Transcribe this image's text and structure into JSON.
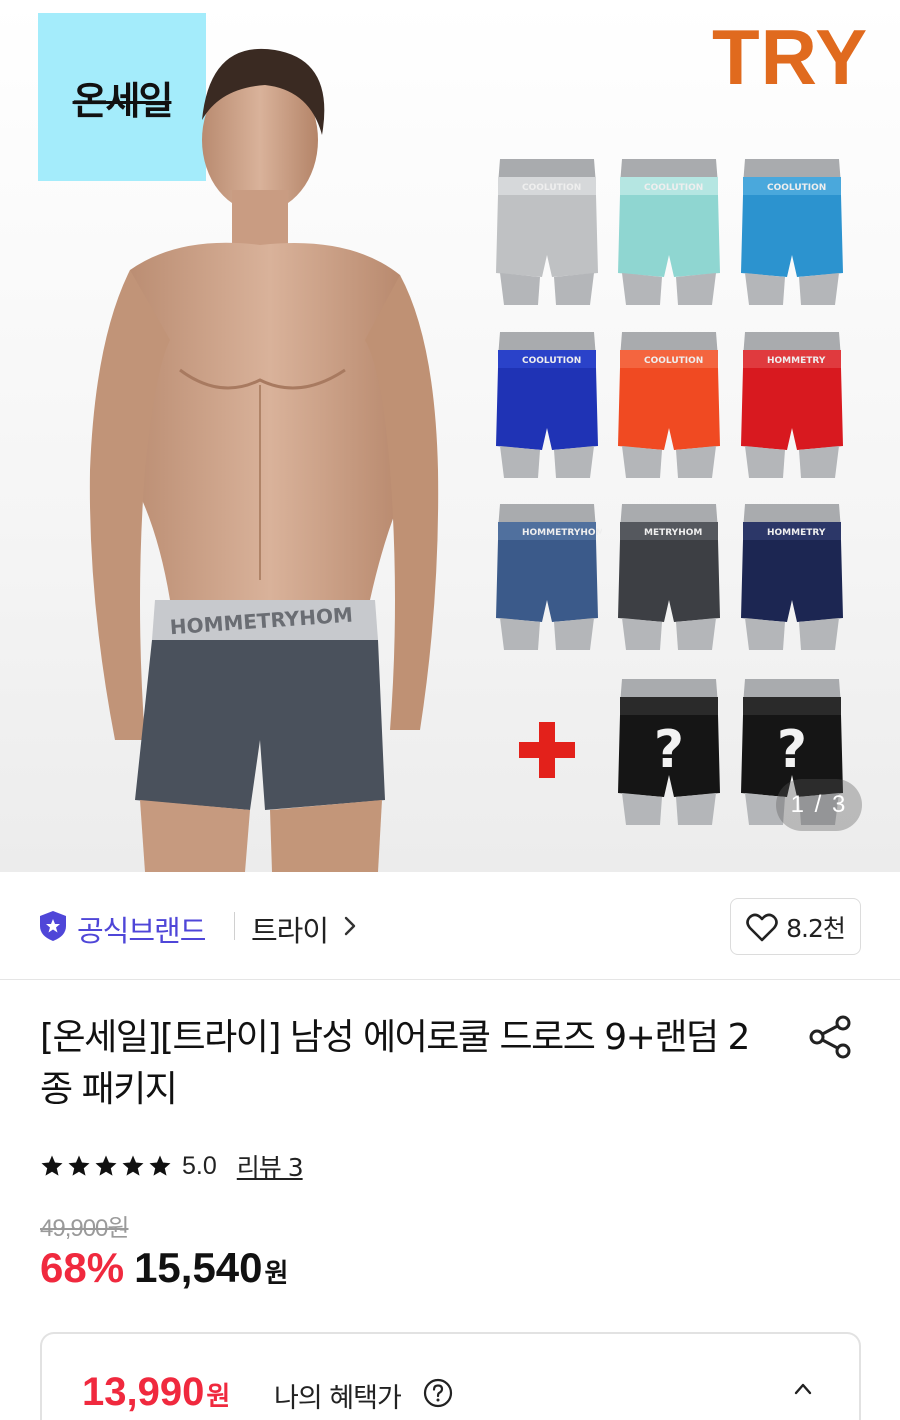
{
  "hero": {
    "badge_text": "온세일",
    "brand_logo": "TRY",
    "counter": "1 / 3",
    "underwear_colors": [
      {
        "color": "#bfc1c3",
        "band": "#d6d8da",
        "band_text": "COOLUTION"
      },
      {
        "color": "#8fd6d1",
        "band": "#b5e6e2",
        "band_text": "COOLUTION"
      },
      {
        "color": "#2c93cf",
        "band": "#4aa8dc",
        "band_text": "COOLUTION"
      },
      {
        "color": "#1f33b5",
        "band": "#2a42c9",
        "band_text": "COOLUTION"
      },
      {
        "color": "#f04a22",
        "band": "#f4653f",
        "band_text": "COOLUTION"
      },
      {
        "color": "#d8191f",
        "band": "#e03a3e",
        "band_text": "HOMMETRY"
      },
      {
        "color": "#3b5a8a",
        "band": "#50709e",
        "band_text": "HOMMETRYHOM"
      },
      {
        "color": "#3d3f44",
        "band": "#55585e",
        "band_text": "METRYHOM"
      },
      {
        "color": "#1c2652",
        "band": "#2c3768",
        "band_text": "HOMMETRY"
      },
      {
        "color": "#151515",
        "band": "#2a2a2a",
        "band_text": "?",
        "mystery": true
      },
      {
        "color": "#151515",
        "band": "#2a2a2a",
        "band_text": "?",
        "mystery": true
      }
    ]
  },
  "brand": {
    "official_label": "공식브랜드",
    "name": "트라이",
    "like_count": "8.2천"
  },
  "product": {
    "title": "[온세일][트라이] 남성 에어로쿨 드로즈 9+랜덤 2종 패키지"
  },
  "rating": {
    "score": "5.0",
    "review_label": "리뷰 3",
    "stars": 5
  },
  "price": {
    "original": "49,900원",
    "discount": "68%",
    "sale": "15,540",
    "unit": "원"
  },
  "benefit": {
    "price": "13,990",
    "unit": "원",
    "label": "나의 혜택가"
  },
  "colors": {
    "brand_purple": "#4f46d8",
    "sale_red": "#f0293e",
    "try_orange": "#e06a1e",
    "badge_cyan": "#a4ecfb"
  }
}
